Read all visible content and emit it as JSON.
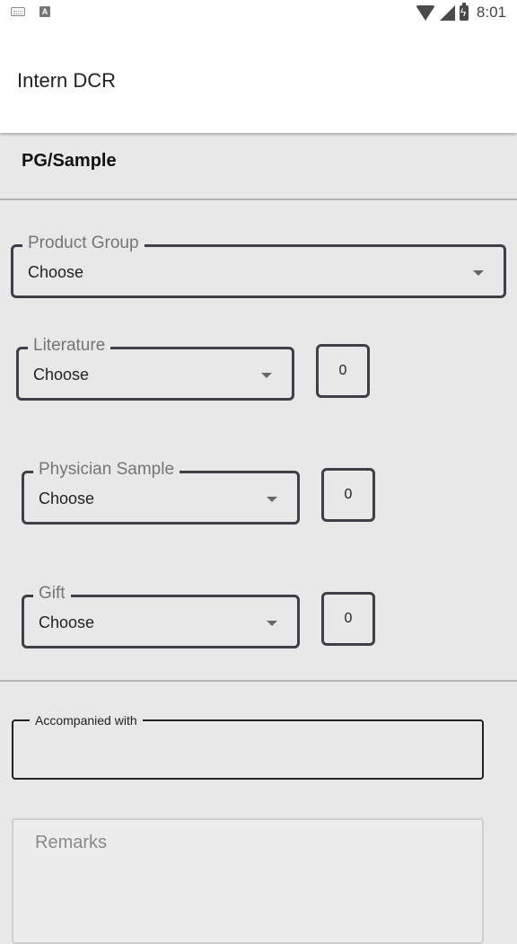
{
  "status_bar": {
    "time": "8:01",
    "icons": [
      "keyboard-icon",
      "a-icon",
      "wifi-icon",
      "signal-icon",
      "battery-charging-icon"
    ]
  },
  "app_bar": {
    "title": "Intern DCR"
  },
  "section": {
    "title": "PG/Sample"
  },
  "product_group": {
    "label": "Product Group",
    "value": "Choose"
  },
  "literature": {
    "label": "Literature",
    "value": "Choose",
    "quantity": "0"
  },
  "physician_sample": {
    "label": "Physician Sample",
    "value": "Choose",
    "quantity": "0"
  },
  "gift": {
    "label": "Gift",
    "value": "Choose",
    "quantity": "0"
  },
  "accompanied_with": {
    "label": "Accompanied with",
    "value": ""
  },
  "remarks": {
    "placeholder": "Remarks"
  },
  "colors": {
    "background": "#e8e8e8",
    "appbar": "#ffffff",
    "field_border": "#3f3f48",
    "label_gray": "#757575"
  }
}
